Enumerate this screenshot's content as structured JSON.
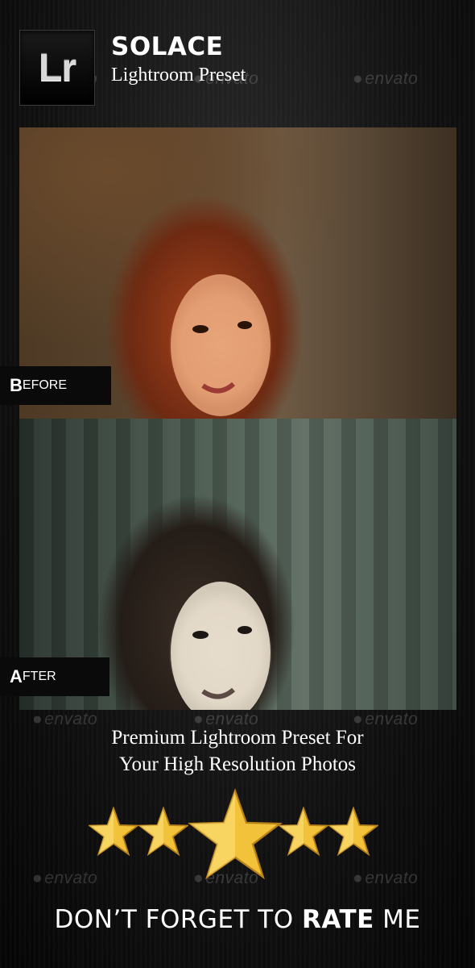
{
  "header": {
    "badge_text": "Lr",
    "title": "SOLACE",
    "subtitle": "Lightroom Preset"
  },
  "photos": {
    "before_label_cap": "B",
    "before_label_rest": "EFORE",
    "after_label_cap": "A",
    "after_label_rest": "FTER"
  },
  "tagline": {
    "line1": "Premium Lightroom Preset For",
    "line2": "Your High Resolution Photos"
  },
  "rating": {
    "stars_shown": 5,
    "star_color": "#f2c23a"
  },
  "footer": {
    "rate_prefix": "DON’T FORGET TO ",
    "rate_bold": "RATE",
    "rate_suffix": " ME"
  },
  "watermark_text": "envato"
}
